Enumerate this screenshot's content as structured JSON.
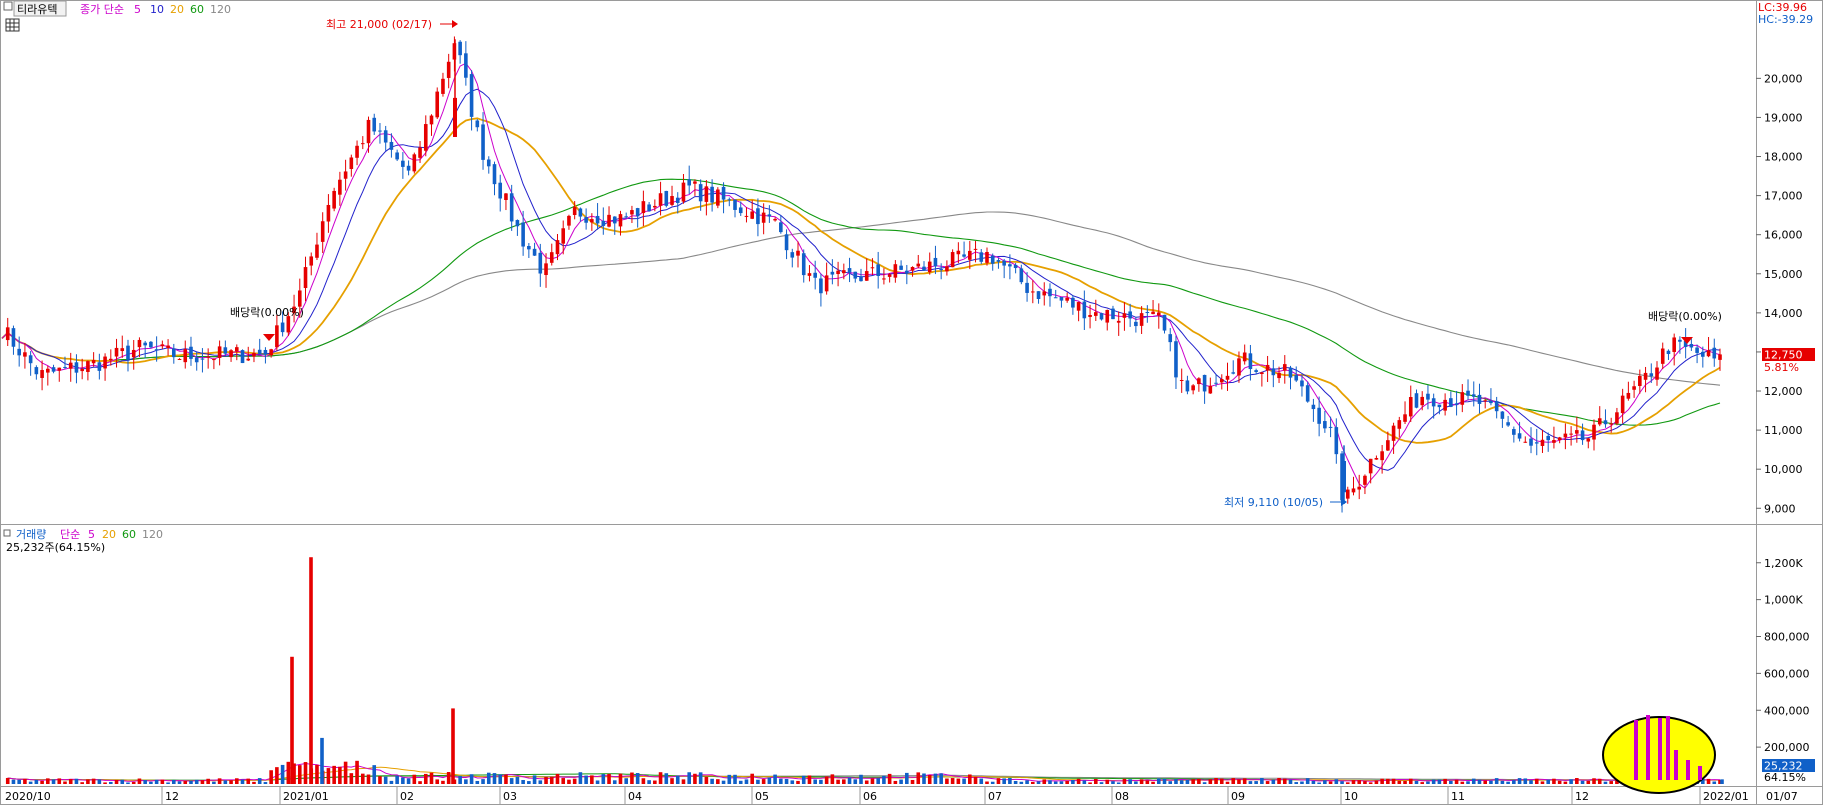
{
  "price_header": {
    "stock_name": "티라유텍",
    "ma_label": "종가 단순",
    "ma_periods": [
      {
        "label": "5",
        "color": "#cc00cc"
      },
      {
        "label": "10",
        "color": "#2222cc"
      },
      {
        "label": "20",
        "color": "#e6a000"
      },
      {
        "label": "60",
        "color": "#119911"
      },
      {
        "label": "120",
        "color": "#888888"
      }
    ],
    "lc_label": "LC:39.96",
    "hc_label": "HC:-39.29"
  },
  "volume_header": {
    "title": "거래량",
    "ma_label": "단순",
    "ma_periods": [
      {
        "label": "5",
        "color": "#cc00cc"
      },
      {
        "label": "20",
        "color": "#e6a000"
      },
      {
        "label": "60",
        "color": "#119911"
      },
      {
        "label": "120",
        "color": "#888888"
      }
    ],
    "last_volume_label": "25,232주(64.15%)"
  },
  "annotations": {
    "high": "최고 21,000 (02/17)",
    "low": "최저 9,110 (10/05)",
    "dividend_1": "배당락(0.00%)",
    "dividend_2": "배당락(0.00%)"
  },
  "current": {
    "price_tag": "12,750",
    "change_tag": "5.81%",
    "volume_tag": "25,232",
    "volume_pct_tag": "64.15%"
  },
  "colors": {
    "up": "#e60000",
    "down": "#1060c8",
    "ma5": "#cc00cc",
    "ma10": "#2222cc",
    "ma20": "#e6a000",
    "ma60": "#119911",
    "ma120": "#888888",
    "highlight": "#ffff00"
  },
  "chart_data": [
    {
      "type": "candlestick",
      "title": "티라유텍",
      "x_tick_labels": [
        "2020/10",
        "12",
        "2021/01",
        "02",
        "03",
        "04",
        "05",
        "06",
        "07",
        "08",
        "09",
        "10",
        "11",
        "12",
        "2022/01",
        "01/07"
      ],
      "y_tick_labels": [
        "20,000",
        "19,000",
        "18,000",
        "17,000",
        "16,000",
        "15,000",
        "14,000",
        "13,000",
        "12,000",
        "11,000",
        "10,000",
        "9,000"
      ],
      "ylim": [
        8700,
        21800
      ],
      "series_close": [
        {
          "x": "2020/10",
          "y": 13600
        },
        {
          "x": "2020/11 early",
          "y": 12400
        },
        {
          "x": "2020/11 mid",
          "y": 12700
        },
        {
          "x": "2020/11 late",
          "y": 13100
        },
        {
          "x": "2020/12",
          "y": 12900
        },
        {
          "x": "2020/12 dividend",
          "y": 12950
        },
        {
          "x": "2021/01 early",
          "y": 14500
        },
        {
          "x": "2021/01 mid",
          "y": 17000
        },
        {
          "x": "2021/01 late",
          "y": 18800
        },
        {
          "x": "2021/02 early",
          "y": 17500
        },
        {
          "x": "2021/02 peak",
          "y": 21000
        },
        {
          "x": "2021/02 late",
          "y": 18300
        },
        {
          "x": "2021/03 early",
          "y": 16000
        },
        {
          "x": "2021/03 mid",
          "y": 15000
        },
        {
          "x": "2021/03 late",
          "y": 16600
        },
        {
          "x": "2021/04 early",
          "y": 16400
        },
        {
          "x": "2021/04 late",
          "y": 17200
        },
        {
          "x": "2021/05 early",
          "y": 16700
        },
        {
          "x": "2021/05 mid",
          "y": 16300
        },
        {
          "x": "2021/05 late",
          "y": 14700
        },
        {
          "x": "2021/06 early",
          "y": 14900
        },
        {
          "x": "2021/06 late",
          "y": 15100
        },
        {
          "x": "2021/07 early",
          "y": 15500
        },
        {
          "x": "2021/07 late",
          "y": 14600
        },
        {
          "x": "2021/08 early",
          "y": 14000
        },
        {
          "x": "2021/08 late",
          "y": 13800
        },
        {
          "x": "2021/09 early",
          "y": 11900
        },
        {
          "x": "2021/09 mid",
          "y": 12800
        },
        {
          "x": "2021/09 late",
          "y": 12400
        },
        {
          "x": "2021/10 early",
          "y": 11000
        },
        {
          "x": "2021/10 low",
          "y": 9110
        },
        {
          "x": "2021/10 late",
          "y": 10600
        },
        {
          "x": "2021/11 early",
          "y": 11900
        },
        {
          "x": "2021/11 late",
          "y": 11700
        },
        {
          "x": "2021/12 early",
          "y": 10600
        },
        {
          "x": "2021/12 mid",
          "y": 10800
        },
        {
          "x": "2021/12 late",
          "y": 12300
        },
        {
          "x": "2021/12 dividend",
          "y": 13200
        },
        {
          "x": "2022/01 early",
          "y": 12750
        }
      ],
      "ma_series": [
        {
          "name": "5",
          "color": "#cc00cc"
        },
        {
          "name": "10",
          "color": "#2222cc"
        },
        {
          "name": "20",
          "color": "#e6a000"
        },
        {
          "name": "60",
          "color": "#119911"
        },
        {
          "name": "120",
          "color": "#888888"
        }
      ]
    },
    {
      "type": "bar",
      "title": "거래량",
      "y_tick_labels": [
        "1,200K",
        "1,000K",
        "800,000",
        "600,000",
        "400,000",
        "200,000"
      ],
      "ylim": [
        0,
        1280000
      ],
      "values": [
        {
          "x": "2021/01 mid",
          "y": 690000
        },
        {
          "x": "2021/01 mid",
          "y": 1230000
        },
        {
          "x": "2021/01 late",
          "y": 250000
        },
        {
          "x": "2021/02 peak",
          "y": 410000
        },
        {
          "x": "2022/01 early",
          "y": 25232
        }
      ]
    }
  ]
}
